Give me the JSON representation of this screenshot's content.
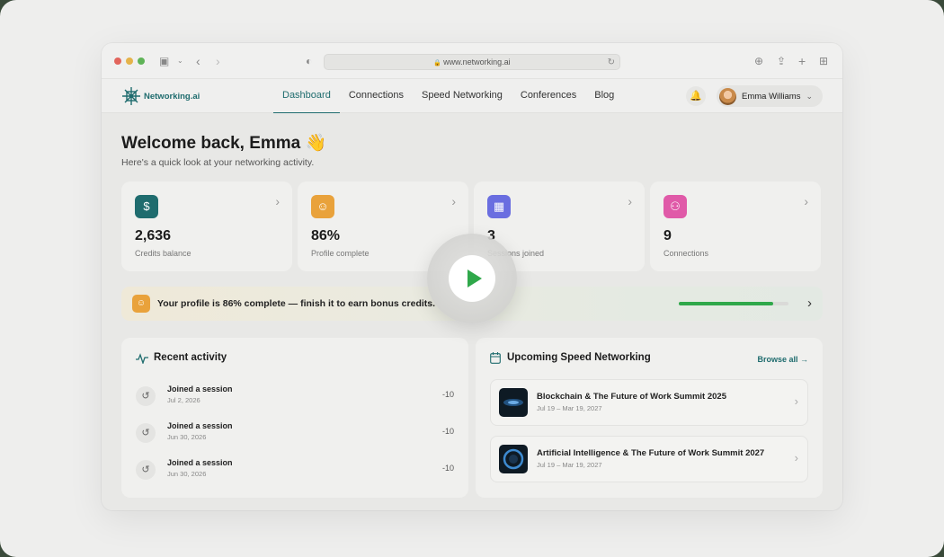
{
  "browser": {
    "url": "www.networking.ai"
  },
  "app": {
    "brand": "Networking.ai",
    "nav": [
      {
        "label": "Dashboard",
        "active": true
      },
      {
        "label": "Connections",
        "active": false
      },
      {
        "label": "Speed Networking",
        "active": false
      },
      {
        "label": "Conferences",
        "active": false
      },
      {
        "label": "Blog",
        "active": false
      }
    ],
    "user_name": "Emma Williams"
  },
  "welcome": {
    "title": "Welcome back, Emma 👋",
    "subtitle": "Here's a quick look at your networking activity."
  },
  "stats": [
    {
      "value": "2,636",
      "label": "Credits balance",
      "icon": "dollar-coin-icon",
      "color": "#1f6c6e"
    },
    {
      "value": "86%",
      "label": "Profile complete",
      "icon": "user-icon",
      "color": "#e9a23b"
    },
    {
      "value": "3",
      "label": "Sessions joined",
      "icon": "calendar-icon",
      "color": "#6a6ee0"
    },
    {
      "value": "9",
      "label": "Connections",
      "icon": "users-icon",
      "color": "#e05aa8"
    }
  ],
  "banner": {
    "text": "Your profile is 86% complete — finish it to earn bonus credits.",
    "progress_percent": 86,
    "progress_color": "#2fa84a"
  },
  "recent_activity": {
    "title": "Recent activity",
    "items": [
      {
        "title": "Joined a session",
        "date": "Jul 2, 2026",
        "amount": "-10"
      },
      {
        "title": "Joined a session",
        "date": "Jun 30, 2026",
        "amount": "-10"
      },
      {
        "title": "Joined a session",
        "date": "Jun 30, 2026",
        "amount": "-10"
      }
    ]
  },
  "upcoming": {
    "title": "Upcoming Speed Networking",
    "browse_label": "Browse all →",
    "events": [
      {
        "title": "Blockchain & The Future of Work Summit 2025",
        "date": "Jul 19 – Mar 19, 2027"
      },
      {
        "title": "Artificial Intelligence & The Future of Work Summit 2027",
        "date": "Jul 19 – Mar 19, 2027"
      }
    ]
  },
  "overlay": {
    "icon": "play-icon",
    "color": "#2fa84a"
  }
}
